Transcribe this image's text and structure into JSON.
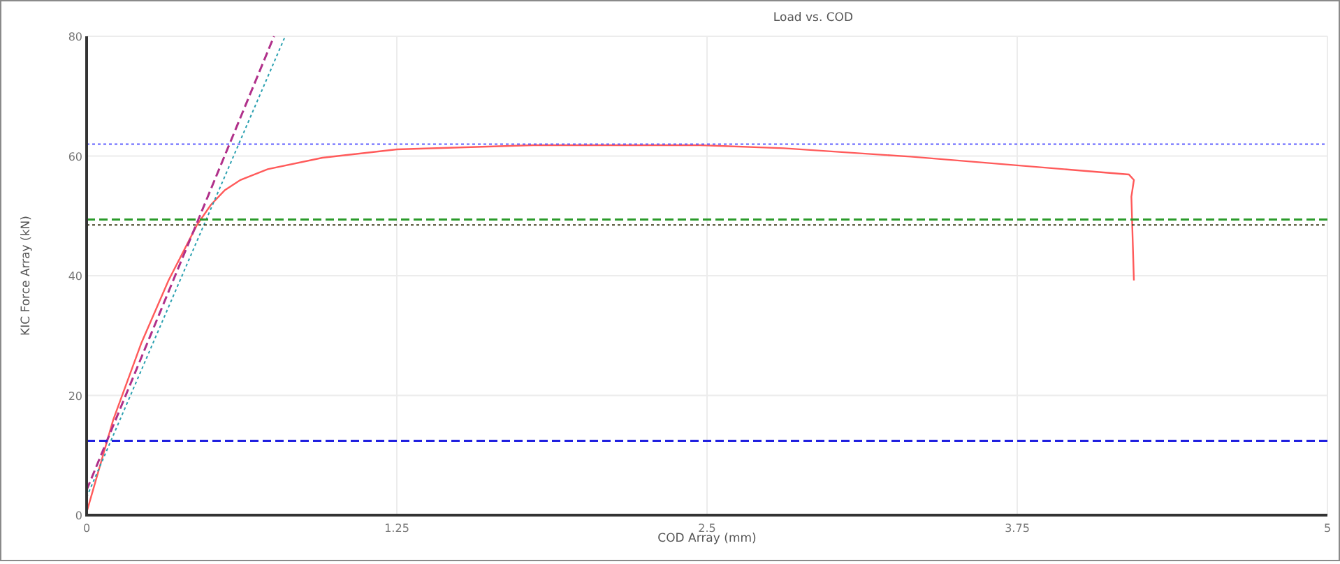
{
  "chart": {
    "chart_data": {
      "type": "line",
      "title": "Load vs. COD",
      "xlabel": "COD Array (mm)",
      "ylabel": "KIC Force Array (kN)",
      "xlim": [
        0,
        5
      ],
      "ylim": [
        0,
        80
      ],
      "grid": true,
      "xticks": [
        0,
        {
          "value": 1.25,
          "label": "1.25"
        },
        {
          "value": 2.5,
          "label": "2.5"
        },
        {
          "value": 3.75,
          "label": "3.75"
        },
        5
      ],
      "yticks": [
        0,
        20,
        40,
        60,
        80
      ],
      "series": [
        {
          "color": "#ff5a5a",
          "line_style": "solid",
          "x": [
            0,
            0.107,
            0.22,
            0.33,
            0.445,
            0.5,
            0.557,
            0.62,
            0.73,
            0.95,
            1.25,
            1.8,
            2.47,
            2.81,
            3.32,
            4.2,
            4.22,
            4.21,
            4.22
          ],
          "values": [
            0.5,
            15.9,
            28.7,
            39.2,
            48.5,
            51.8,
            54.3,
            56,
            57.8,
            59.7,
            61.1,
            61.8,
            61.8,
            61.3,
            59.9,
            56.9,
            56,
            53.2,
            39.2
          ]
        },
        {
          "color": "#b0308a",
          "line_style": "dashed",
          "x": [
            0,
            0.755
          ],
          "values": [
            4.2,
            80
          ]
        },
        {
          "color": "#2aa0b0",
          "line_style": "dotted",
          "x": [
            0,
            0.8
          ],
          "values": [
            3,
            80
          ]
        },
        {
          "color": "#6060ff",
          "line_style": "dotted",
          "x": [
            0,
            5
          ],
          "values": [
            62,
            62
          ]
        },
        {
          "color": "#2a9a2a",
          "line_style": "dashed",
          "x": [
            0,
            5
          ],
          "values": [
            49.4,
            49.4
          ]
        },
        {
          "color": "#404020",
          "line_style": "dotted",
          "x": [
            0,
            5
          ],
          "values": [
            48.5,
            48.5
          ]
        },
        {
          "color": "#2020e0",
          "line_style": "dashed",
          "x": [
            0,
            5
          ],
          "values": [
            12.4,
            12.4
          ]
        }
      ]
    }
  }
}
